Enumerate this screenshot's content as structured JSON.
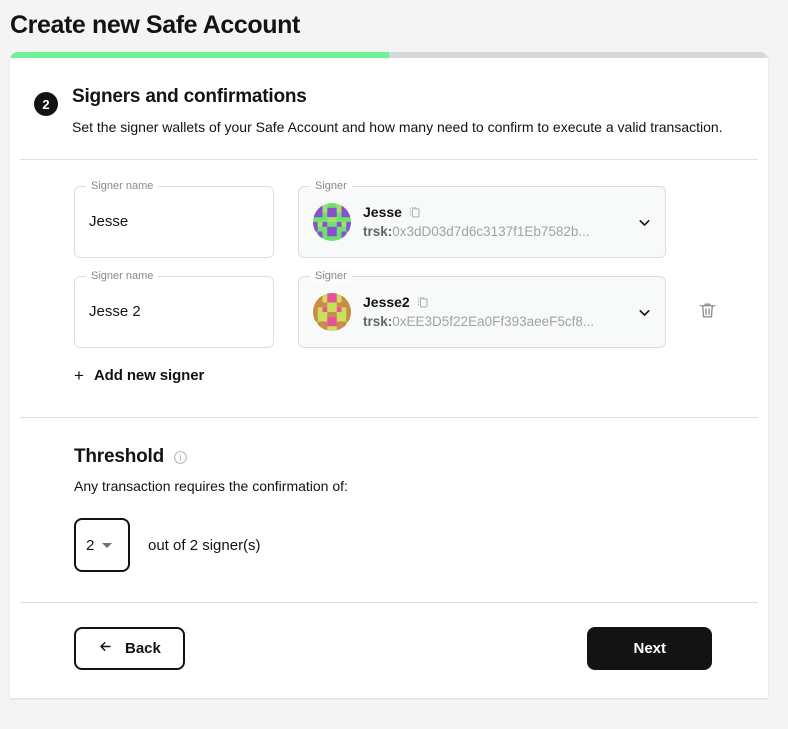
{
  "page": {
    "title": "Create new Safe Account"
  },
  "progress": {
    "percent": 50,
    "fill_color": "#72f095",
    "track_color": "#d6d9d9"
  },
  "step": {
    "number": "2",
    "title": "Signers and confirmations",
    "subtitle": "Set the signer wallets of your Safe Account and how many need to confirm to execute a valid transaction."
  },
  "signers": {
    "name_legend": "Signer name",
    "signer_legend": "Signer",
    "add_new_label": "Add new signer",
    "rows": [
      {
        "name_value": "Jesse",
        "signer_name": "Jesse",
        "address_prefix": "trsk:",
        "address": "0x3dD03d7d6c3137f1Eb7582b...",
        "avatar_colors": [
          "#6ee06e",
          "#8a4fd1",
          "#a7e06e"
        ],
        "has_delete": false
      },
      {
        "name_value": "Jesse 2",
        "signer_name": "Jesse2",
        "address_prefix": "trsk:",
        "address": "0xEE3D5f22Ea0Ff393aeeF5cf8...",
        "avatar_colors": [
          "#c8e05a",
          "#e8509a",
          "#c98a4a"
        ],
        "has_delete": true
      }
    ]
  },
  "threshold": {
    "title": "Threshold",
    "description": "Any transaction requires the confirmation of:",
    "selected_value": "2",
    "out_of_label": "out of 2 signer(s)"
  },
  "footer": {
    "back_label": "Back",
    "next_label": "Next"
  },
  "icons": {
    "copy": "copy-icon",
    "chevron_down": "chevron-down-icon",
    "trash": "trash-icon",
    "info": "info-icon",
    "plus": "+",
    "arrow_left": "arrow-left-icon"
  }
}
